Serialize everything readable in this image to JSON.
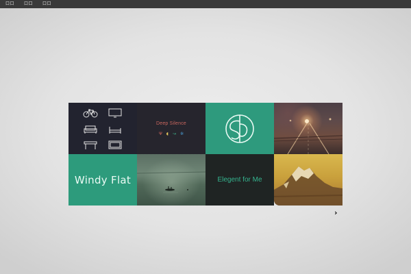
{
  "menu": {
    "items": [
      "口口",
      "口口",
      "口口"
    ]
  },
  "tiles": {
    "deep_silence": {
      "title": "Deep Silence",
      "glyphs": [
        "Ψ",
        "◖",
        "↝",
        "✲"
      ],
      "glyph_colors": [
        "#d86a5e",
        "#e2c35a",
        "#3fae87",
        "#4a9ed6"
      ]
    },
    "windy_flat": {
      "title": "Windy Flat"
    },
    "elegant": {
      "title": "Elegent for Me"
    },
    "icons": [
      "bicycle-icon",
      "monitor-icon",
      "sofa-icon",
      "bed-icon",
      "table-icon",
      "tv-icon"
    ]
  },
  "navigation": {
    "next_glyph": "›"
  },
  "colors": {
    "accent_teal": "#2e9a7d",
    "dark_tile": "#22232f",
    "topbar": "#3a3a3a"
  }
}
